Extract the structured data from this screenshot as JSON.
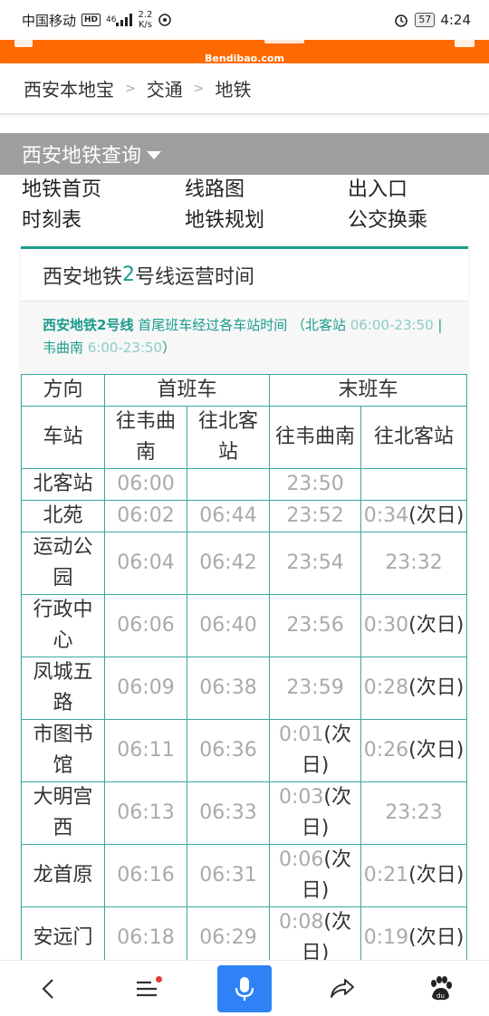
{
  "status": {
    "carrier": "中国移动",
    "hd": "HD",
    "network": "46",
    "speed_value": "2.2",
    "speed_unit": "K/s",
    "battery": "57",
    "time": "4:24",
    "icons": [
      "hd-badge-icon",
      "signal-icon",
      "location-icon",
      "alarm-icon",
      "battery-icon"
    ]
  },
  "site": {
    "logo": "Bendibao.com",
    "brand_color": "#ff6a00"
  },
  "breadcrumb": {
    "items": [
      "西安本地宝",
      "交通",
      "地铁"
    ],
    "separator": ">"
  },
  "section": {
    "title": "西安地铁查询"
  },
  "links": [
    "地铁首页",
    "线路图",
    "出入口",
    "时刻表",
    "地铁规划",
    "公交换乘"
  ],
  "card": {
    "title_pre": "西安地铁",
    "title_num": "2",
    "title_post": "号线运营时间",
    "intro_line_name": "西安地铁2号线",
    "intro_text": " 首尾班车经过各车站时间 （北客站 ",
    "intro_time1": "06:00-23:50",
    "intro_mid": " | 韦曲南 ",
    "intro_time2": "6:00-23:50",
    "intro_end": "）",
    "accent_color": "#1a9c8c"
  },
  "table": {
    "h_direction": "方向",
    "h_first": "首班车",
    "h_last": "末班车",
    "h_station": "车站",
    "h_to_weiqunan": "往韦曲南",
    "h_to_beikezhan": "往北客站",
    "h_to_weiqunan2": "往韦曲南",
    "h_to_beikezhan2": "往北客站",
    "rows": [
      {
        "station": "北客站",
        "f1": "06:00",
        "f2": "",
        "l1": "23:50",
        "l2": ""
      },
      {
        "station": "北苑",
        "f1": "06:02",
        "f2": "06:44",
        "l1": "23:52",
        "l2": "0:34(次日)"
      },
      {
        "station": "运动公园",
        "f1": "06:04",
        "f2": "06:42",
        "l1": "23:54",
        "l2": "23:32"
      },
      {
        "station": "行政中心",
        "f1": "06:06",
        "f2": "06:40",
        "l1": "23:56",
        "l2": "0:30(次日)"
      },
      {
        "station": "凤城五路",
        "f1": "06:09",
        "f2": "06:38",
        "l1": "23:59",
        "l2": "0:28(次日)"
      },
      {
        "station": "市图书馆",
        "f1": "06:11",
        "f2": "06:36",
        "l1": "0:01(次日)",
        "l2": "0:26(次日)"
      },
      {
        "station": "大明宫西",
        "f1": "06:13",
        "f2": "06:33",
        "l1": "0:03(次日)",
        "l2": "23:23"
      },
      {
        "station": "龙首原",
        "f1": "06:16",
        "f2": "06:31",
        "l1": "0:06(次日)",
        "l2": "0:21(次日)"
      },
      {
        "station": "安远门",
        "f1": "06:18",
        "f2": "06:29",
        "l1": "0:08(次日)",
        "l2": "0:19(次日)"
      }
    ]
  },
  "bottom_nav": {
    "items": [
      "back-icon",
      "menu-icon",
      "mic-icon",
      "share-icon",
      "baidu-paw-icon"
    ],
    "mic_color": "#2f82f5"
  }
}
